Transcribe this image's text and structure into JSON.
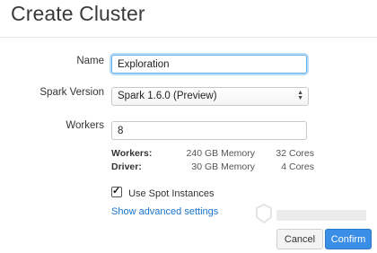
{
  "dialog": {
    "title": "Create Cluster"
  },
  "form": {
    "name_label": "Name",
    "name_value": "Exploration",
    "spark_version_label": "Spark Version",
    "spark_version_value": "Spark 1.6.0 (Preview)",
    "workers_label": "Workers",
    "workers_value": "8"
  },
  "stats": {
    "workers": {
      "label": "Workers:",
      "memory": "240 GB Memory",
      "cores": "32 Cores"
    },
    "driver": {
      "label": "Driver:",
      "memory": "30 GB Memory",
      "cores": "4 Cores"
    }
  },
  "options": {
    "spot_label": "Use Spot Instances",
    "spot_checked": true,
    "advanced_link": "Show advanced settings"
  },
  "buttons": {
    "cancel": "Cancel",
    "confirm": "Confirm"
  },
  "colors": {
    "link": "#1a73c9",
    "primary": "#3a8ee6",
    "focus": "#66afe9"
  }
}
